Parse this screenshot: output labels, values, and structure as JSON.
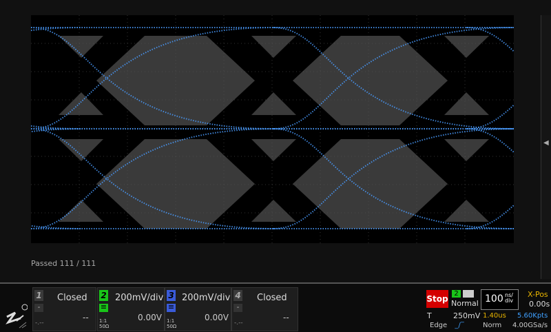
{
  "status": {
    "test_label": "Passed",
    "passed": "111",
    "total": "111",
    "sep": "/"
  },
  "channels": [
    {
      "num": "1",
      "label": "Closed",
      "offset": "--",
      "dash": "-.--",
      "color": "#cccccc",
      "impedance": ""
    },
    {
      "num": "2",
      "label": "200mV/div",
      "offset": "0.00V",
      "dash": "",
      "color": "#19c519",
      "impedance_top": "1:1",
      "impedance_bottom": "50Ω"
    },
    {
      "num": "3",
      "label": "200mV/div",
      "offset": "0.00V",
      "dash": "",
      "color": "#3a5bd9",
      "impedance_top": "1:1",
      "impedance_bottom": "50Ω"
    },
    {
      "num": "4",
      "label": "Closed",
      "offset": "--",
      "dash": "-.--",
      "color": "#cccccc",
      "impedance": ""
    }
  ],
  "trigger": {
    "run_state": "Stop",
    "source": "2",
    "mode": "Normal",
    "t_label": "T",
    "level": "250mV",
    "type": "Edge"
  },
  "timebase": {
    "scale": "100",
    "unit_top": "ns/",
    "unit_bottom": "div",
    "xpos_label": "X-Pos",
    "xpos_value": "0.00s",
    "delay": "1.40us",
    "points": "5.60Kpts",
    "acq_mode": "Norm",
    "sample_rate": "4.00GSa/s"
  },
  "colors": {
    "trace": "#4a9cff",
    "mask": "#000000",
    "background": "#3a3a3a",
    "stop": "#d40000"
  },
  "icons": {
    "logo": "zlg-logo-icon",
    "side": "chevron-left-icon"
  }
}
